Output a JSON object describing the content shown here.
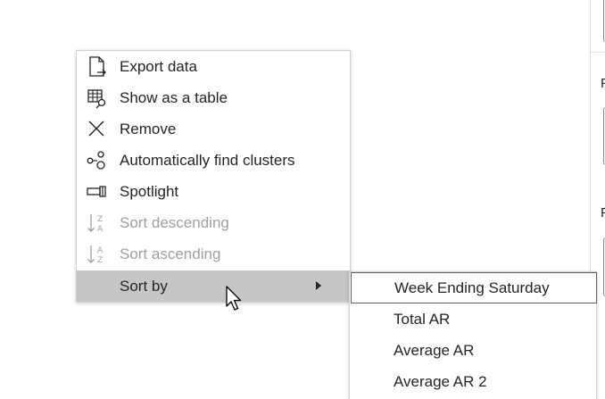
{
  "context_menu": {
    "items": [
      {
        "label": "Export data",
        "icon": "export-data-icon",
        "enabled": true
      },
      {
        "label": "Show as a table",
        "icon": "show-as-table-icon",
        "enabled": true
      },
      {
        "label": "Remove",
        "icon": "remove-icon",
        "enabled": true
      },
      {
        "label": "Automatically find clusters",
        "icon": "clusters-icon",
        "enabled": true
      },
      {
        "label": "Spotlight",
        "icon": "spotlight-icon",
        "enabled": true
      },
      {
        "label": "Sort descending",
        "icon": "sort-descending-icon",
        "enabled": false
      },
      {
        "label": "Sort ascending",
        "icon": "sort-ascending-icon",
        "enabled": false
      },
      {
        "label": "Sort by",
        "icon": "",
        "enabled": true,
        "has_submenu": true,
        "hovered": true
      }
    ]
  },
  "sort_by_submenu": {
    "items": [
      {
        "label": "Week Ending Saturday",
        "focused": true
      },
      {
        "label": "Total AR"
      },
      {
        "label": "Average AR"
      },
      {
        "label": "Average AR 2"
      }
    ]
  },
  "side_pane": {
    "label_1": "F",
    "label_2": "F"
  },
  "colors": {
    "menu_hover": "#c8c6c4",
    "text": "#252423",
    "disabled_text": "#a19f9d",
    "border": "#d2d0ce"
  }
}
